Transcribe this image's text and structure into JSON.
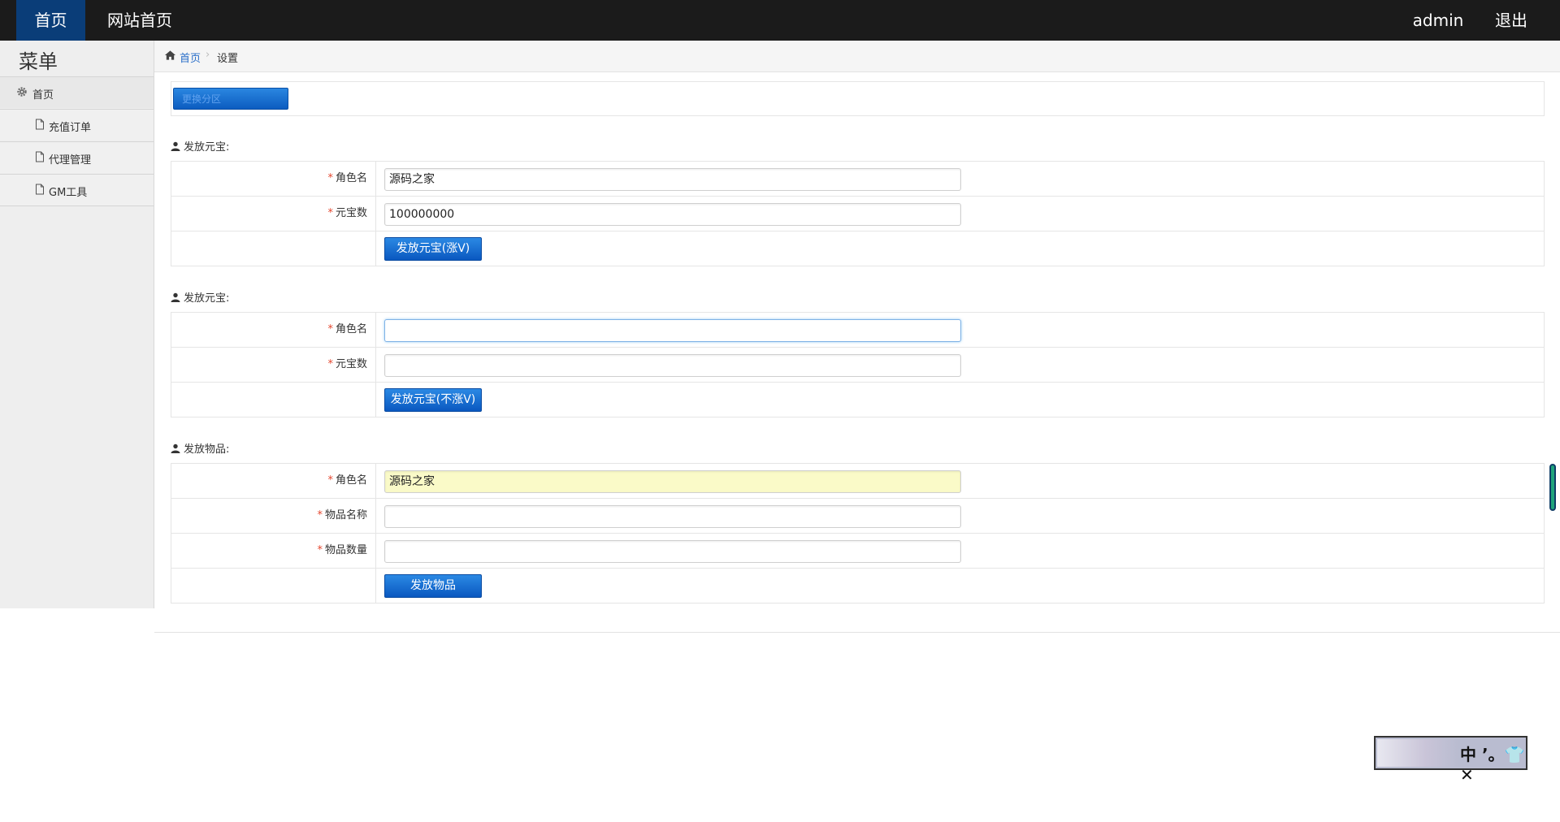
{
  "topnav": {
    "home": "首页",
    "site_home": "网站首页",
    "user": "admin",
    "logout": "退出",
    "active_color": "#0a3d78"
  },
  "sidebar": {
    "title": "菜单",
    "home": "首页",
    "items": [
      {
        "label": "充值订单"
      },
      {
        "label": "代理管理"
      },
      {
        "label": "GM工具"
      }
    ]
  },
  "breadcrumb": {
    "home": "首页",
    "separator": "›",
    "current": "设置"
  },
  "zone_switch": {
    "label": "更换分区"
  },
  "sections": [
    {
      "title": "发放元宝:",
      "fields": [
        {
          "label": "角色名",
          "value": "源码之家"
        },
        {
          "label": "元宝数",
          "value": "100000000"
        }
      ],
      "button": "发放元宝(涨V)"
    },
    {
      "title": "发放元宝:",
      "fields": [
        {
          "label": "角色名",
          "value": ""
        },
        {
          "label": "元宝数",
          "value": ""
        }
      ],
      "button": "发放元宝(不涨V)"
    },
    {
      "title": "发放物品:",
      "fields": [
        {
          "label": "角色名",
          "value": "源码之家"
        },
        {
          "label": "物品名称",
          "value": ""
        },
        {
          "label": "物品数量",
          "value": ""
        }
      ],
      "button": "发放物品"
    }
  ],
  "required_mark": "*",
  "ime": {
    "text": "中 ’。👕 ✕"
  }
}
